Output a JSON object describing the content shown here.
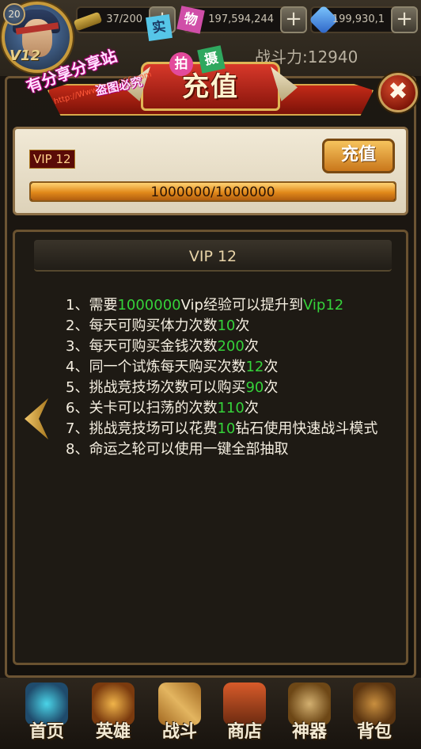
{
  "hud": {
    "player_level": "20",
    "vip_tag": "V12",
    "keys": "37/200",
    "gold": "197,594,244",
    "diamonds": "199,930,1",
    "power_label": "战斗力:12940",
    "plus": "+"
  },
  "watermark": {
    "line1": "有分享分享站",
    "box1": "实",
    "box2": "物",
    "box3": "拍",
    "box4": "摄",
    "url": "http://Www.BL20066.com",
    "line2": "盗图必究"
  },
  "dialog": {
    "title": "充值",
    "close": "✖",
    "vip_level": "VIP 12",
    "recharge_label": "充值",
    "progress_text": "1000000/1000000",
    "progress_value": 1.0
  },
  "privileges": {
    "title": "VIP 12",
    "items": [
      {
        "pre": "1、需要",
        "hl": "1000000",
        "mid": "Vip经验可以提升到",
        "hl2": "Vip12",
        "post": ""
      },
      {
        "pre": "2、每天可购买体力次数",
        "hl": "10",
        "mid": "次",
        "hl2": "",
        "post": ""
      },
      {
        "pre": "3、每天可购买金钱次数",
        "hl": "200",
        "mid": "次",
        "hl2": "",
        "post": ""
      },
      {
        "pre": "4、同一个试炼每天购买次数",
        "hl": "12",
        "mid": "次",
        "hl2": "",
        "post": ""
      },
      {
        "pre": "5、挑战竞技场次数可以购买",
        "hl": "90",
        "mid": "次",
        "hl2": "",
        "post": ""
      },
      {
        "pre": "6、关卡可以扫荡的次数",
        "hl": "110",
        "mid": "次",
        "hl2": "",
        "post": ""
      },
      {
        "pre": "7、挑战竞技场可以花费",
        "hl": "10",
        "mid": "钻石使用快速战斗模式",
        "hl2": "",
        "post": ""
      },
      {
        "pre": "8、命运之轮可以使用一键全部抽取",
        "hl": "",
        "mid": "",
        "hl2": "",
        "post": ""
      }
    ]
  },
  "nav": {
    "items": [
      "首页",
      "英雄",
      "战斗",
      "商店",
      "神器",
      "背包"
    ]
  }
}
